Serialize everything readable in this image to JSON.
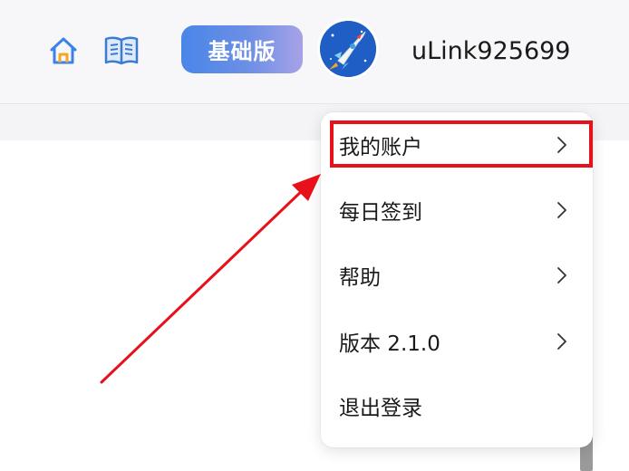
{
  "header": {
    "home_icon": "home-icon",
    "book_icon": "book-icon",
    "plan_badge": "基础版",
    "avatar_icon": "rocket-icon",
    "username": "uLink925699"
  },
  "menu": {
    "items": [
      {
        "label": "我的账户",
        "has_chevron": true,
        "highlighted": true
      },
      {
        "label": "每日签到",
        "has_chevron": true
      },
      {
        "label": "帮助",
        "has_chevron": true
      },
      {
        "label": "版本 2.1.0",
        "has_chevron": true
      },
      {
        "label": "退出登录",
        "has_chevron": false
      }
    ]
  },
  "annotation": {
    "highlight_color": "#e8101a",
    "arrow_color": "#e8101a"
  },
  "colors": {
    "badge_gradient_start": "#4a86e8",
    "badge_gradient_end": "#a7a2e6",
    "avatar_bg": "#1f5fc5"
  }
}
